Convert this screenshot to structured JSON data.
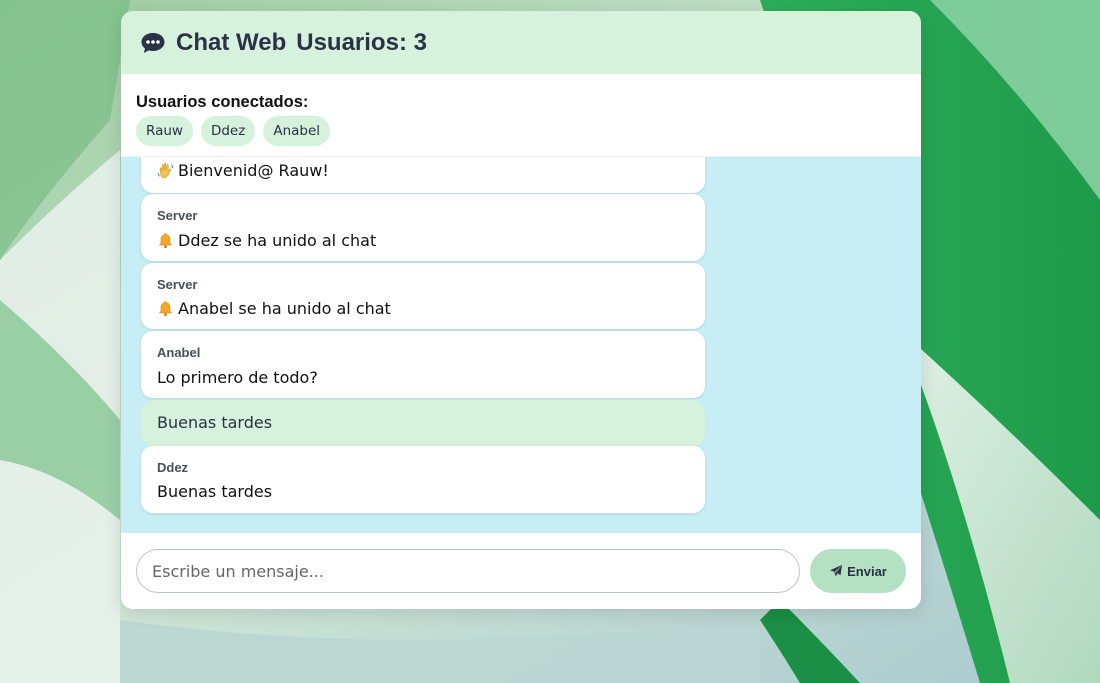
{
  "app": {
    "title": "Chat Web",
    "user_count_label": "Usuarios: 3"
  },
  "users_panel": {
    "heading": "Usuarios conectados:",
    "users": [
      "Rauw",
      "Ddez",
      "Anabel"
    ]
  },
  "messages": [
    {
      "sender": "",
      "text": "Bienvenid@ Rauw!",
      "icon": "waving-hand-icon",
      "self": false
    },
    {
      "sender": "Server",
      "text": "Ddez se ha unido al chat",
      "icon": "bell-icon",
      "self": false
    },
    {
      "sender": "Server",
      "text": "Anabel se ha unido al chat",
      "icon": "bell-icon",
      "self": false
    },
    {
      "sender": "Anabel",
      "text": "Lo primero de todo?",
      "icon": "",
      "self": false
    },
    {
      "sender": "",
      "text": "Buenas tardes",
      "icon": "",
      "self": true
    },
    {
      "sender": "Ddez",
      "text": "Buenas tardes",
      "icon": "",
      "self": false
    }
  ],
  "composer": {
    "placeholder": "Escribe un mensaje...",
    "value": "",
    "send_label": "Enviar",
    "send_icon": "paper-plane-icon"
  },
  "colors": {
    "header_bg": "#d6f1dc",
    "messages_bg": "#c7eef5",
    "send_button_bg": "#b4e1c1",
    "accent_text": "#2b3147"
  }
}
